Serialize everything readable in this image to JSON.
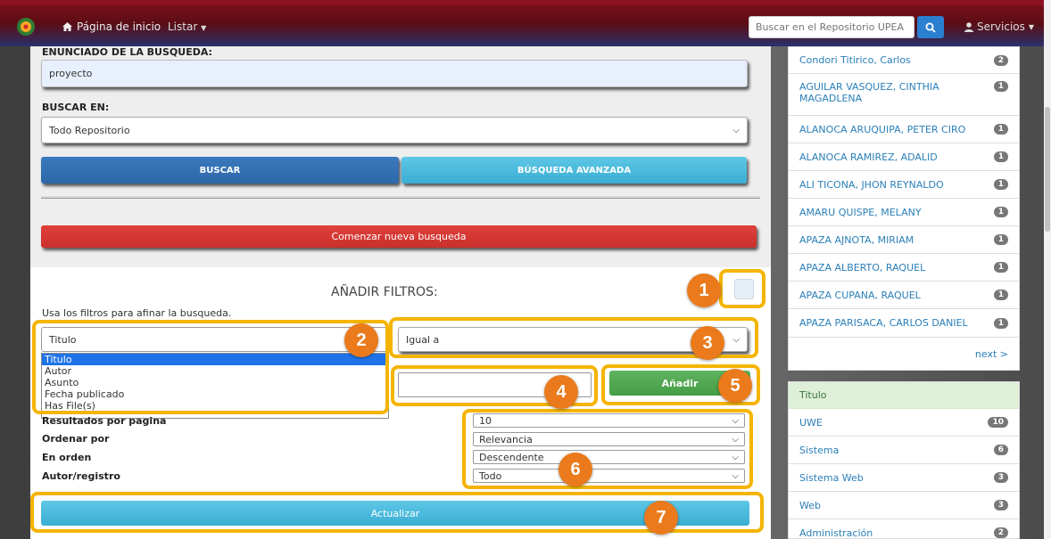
{
  "nav": {
    "home": "Página de inicio",
    "list": "Listar",
    "search_placeholder": "Buscar en el Repositorio UPEA",
    "services": "Servicios"
  },
  "search": {
    "enunciado_label": "ENUNCIADO DE LA BUSQUEDA:",
    "query_value": "proyecto",
    "buscar_en_label": "BUSCAR EN:",
    "scope_value": "Todo Repositorio",
    "buscar_btn": "BUSCAR",
    "avanzada_btn": "BÚSQUEDA AVANZADA",
    "nueva_btn": "Comenzar nueva busqueda"
  },
  "filters": {
    "title": "AÑADIR FILTROS:",
    "hint": "Usa los filtros para afinar la busqueda.",
    "field_value": "Titulo",
    "field_options": [
      "Titulo",
      "Autor",
      "Asunto",
      "Fecha publicado",
      "Has File(s)"
    ],
    "operator_value": "Igual a",
    "add_btn": "Añadir"
  },
  "display": {
    "rows": [
      {
        "label": "Resultados por pagina",
        "value": "10"
      },
      {
        "label": "Ordenar por",
        "value": "Relevancia"
      },
      {
        "label": "En orden",
        "value": "Descendente"
      },
      {
        "label": "Autor/registro",
        "value": "Todo"
      }
    ],
    "update_btn": "Actualizar"
  },
  "badges": [
    "1",
    "2",
    "3",
    "4",
    "5",
    "6",
    "7"
  ],
  "authors": [
    {
      "name": "Condori Titirico, Carlos",
      "count": "2"
    },
    {
      "name": "AGUILAR VASQUEZ, CINTHIA MAGADLENA",
      "count": "1"
    },
    {
      "name": "ALANOCA ARUQUIPA, PETER CIRO",
      "count": "1"
    },
    {
      "name": "ALANOCA RAMIREZ, ADALID",
      "count": "1"
    },
    {
      "name": "ALI TICONA, JHON REYNALDO",
      "count": "1"
    },
    {
      "name": "AMARU QUISPE, MELANY",
      "count": "1"
    },
    {
      "name": "APAZA AJNOTA, MIRIAM",
      "count": "1"
    },
    {
      "name": "APAZA ALBERTO, RAQUEL",
      "count": "1"
    },
    {
      "name": "APAZA CUPANA, RAQUEL",
      "count": "1"
    },
    {
      "name": "APAZA PARISACA, CARLOS DANIEL",
      "count": "1"
    }
  ],
  "authors_next": "next >",
  "title_facet": {
    "heading": "Titulo",
    "items": [
      {
        "name": "UWE",
        "count": "10"
      },
      {
        "name": "Sistema",
        "count": "6"
      },
      {
        "name": "Sistema Web",
        "count": "3"
      },
      {
        "name": "Web",
        "count": "3"
      },
      {
        "name": "Administración",
        "count": "2"
      }
    ]
  }
}
